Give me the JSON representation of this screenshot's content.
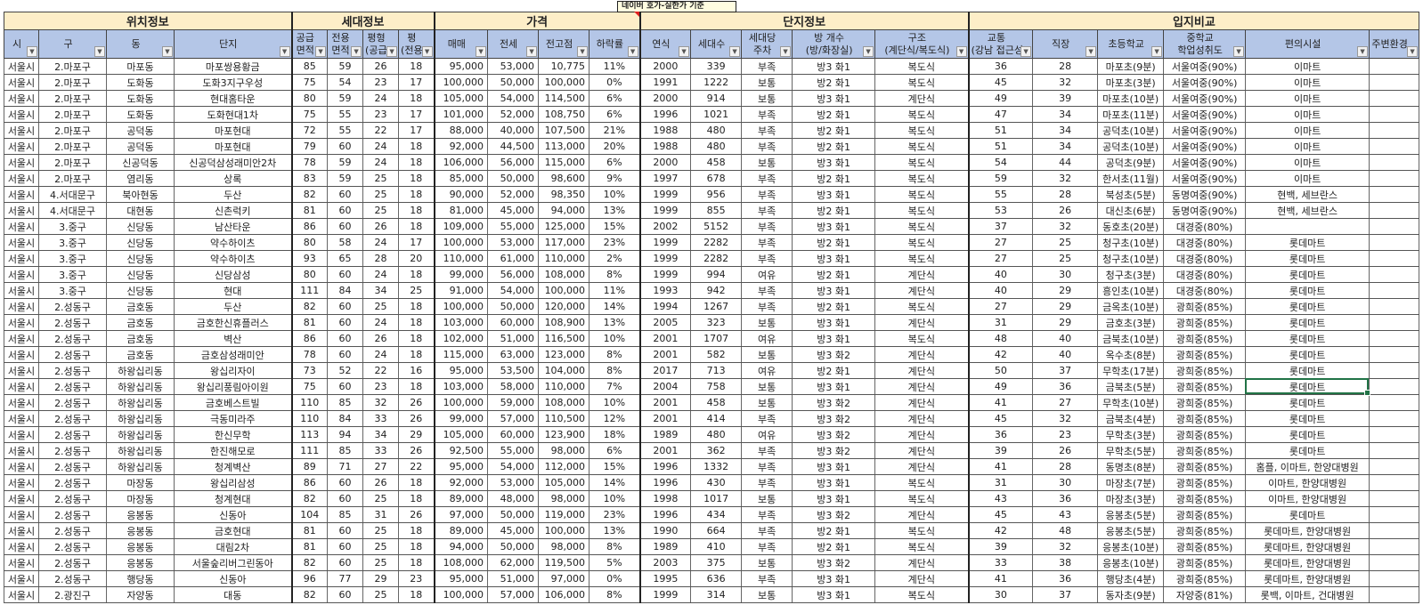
{
  "comment": "네이버 호가-실한가 기준",
  "groups": [
    {
      "label": "위치정보",
      "span": 4
    },
    {
      "label": "세대정보",
      "span": 4
    },
    {
      "label": "가격",
      "span": 4
    },
    {
      "label": "단지정보",
      "span": 5
    },
    {
      "label": "입지비교",
      "span": 6
    }
  ],
  "columns": [
    "시",
    "구",
    "동",
    "단지",
    "공급\n면적",
    "전용\n면적",
    "평형\n(공급)",
    "평\n(전용)",
    "매매",
    "전세",
    "전고점",
    "하락률",
    "연식",
    "세대수",
    "세대당\n주차",
    "방 개수\n(방/화장실)",
    "구조\n(계단식/복도식)",
    "교통\n(강남 접근성)",
    "직장",
    "초등학교",
    "중학교\n학업성취도",
    "편의시설",
    "주변환경"
  ],
  "selected_cell": {
    "row": 21,
    "column": "편의시설"
  },
  "rows": [
    [
      "서울시",
      "2.마포구",
      "마포동",
      "마포쌍용황금",
      "85",
      "59",
      "26",
      "18",
      "95,000",
      "53,000",
      "10,775",
      "11%",
      "2000",
      "339",
      "부족",
      "방3 화1",
      "복도식",
      "36",
      "28",
      "마포초(9분)",
      "서울여중(90%)",
      "이마트",
      ""
    ],
    [
      "서울시",
      "2.마포구",
      "도화동",
      "도화3지구우성",
      "75",
      "54",
      "23",
      "17",
      "100,000",
      "50,000",
      "100,000",
      "0%",
      "1991",
      "1222",
      "보통",
      "방2 화1",
      "복도식",
      "45",
      "32",
      "마포초(3분)",
      "서울여중(90%)",
      "이마트",
      ""
    ],
    [
      "서울시",
      "2.마포구",
      "도화동",
      "현대홈타운",
      "80",
      "59",
      "24",
      "18",
      "105,000",
      "54,000",
      "114,500",
      "6%",
      "2000",
      "914",
      "보통",
      "방3 화1",
      "계단식",
      "49",
      "39",
      "마포초(10분)",
      "서울여중(90%)",
      "이마트",
      ""
    ],
    [
      "서울시",
      "2.마포구",
      "도화동",
      "도화현대1차",
      "75",
      "55",
      "23",
      "17",
      "101,000",
      "52,000",
      "108,750",
      "6%",
      "1996",
      "1021",
      "부족",
      "방2 화1",
      "복도식",
      "47",
      "34",
      "마포초(11분)",
      "서울여중(90%)",
      "이마트",
      ""
    ],
    [
      "서울시",
      "2.마포구",
      "공덕동",
      "마포현대",
      "72",
      "55",
      "22",
      "17",
      "88,000",
      "40,000",
      "107,500",
      "21%",
      "1988",
      "480",
      "부족",
      "방2 화1",
      "복도식",
      "51",
      "34",
      "공덕초(10분)",
      "서울여중(90%)",
      "이마트",
      ""
    ],
    [
      "서울시",
      "2.마포구",
      "공덕동",
      "마포현대",
      "79",
      "60",
      "24",
      "18",
      "92,000",
      "44,500",
      "113,000",
      "20%",
      "1988",
      "480",
      "부족",
      "방2 화1",
      "복도식",
      "51",
      "34",
      "공덕초(10분)",
      "서울여중(90%)",
      "이마트",
      ""
    ],
    [
      "서울시",
      "2.마포구",
      "신공덕동",
      "신공덕삼성래미안2차",
      "78",
      "59",
      "24",
      "18",
      "106,000",
      "56,000",
      "115,000",
      "6%",
      "2000",
      "458",
      "보통",
      "방3 화1",
      "복도식",
      "54",
      "44",
      "공덕초(9분)",
      "서울여중(90%)",
      "이마트",
      ""
    ],
    [
      "서울시",
      "2.마포구",
      "염리동",
      "상록",
      "83",
      "59",
      "25",
      "18",
      "85,000",
      "50,000",
      "98,600",
      "9%",
      "1997",
      "678",
      "부족",
      "방2 화1",
      "복도식",
      "59",
      "32",
      "한서초(11월)",
      "서울여중(90%)",
      "이마트",
      ""
    ],
    [
      "서울시",
      "4.서대문구",
      "북아현동",
      "두산",
      "82",
      "60",
      "25",
      "18",
      "90,000",
      "52,000",
      "98,350",
      "10%",
      "1999",
      "956",
      "부족",
      "방3 화1",
      "복도식",
      "55",
      "28",
      "북성초(5분)",
      "동명여중(90%)",
      "현백, 세브란스",
      ""
    ],
    [
      "서울시",
      "4.서대문구",
      "대현동",
      "신촌럭키",
      "81",
      "60",
      "25",
      "18",
      "81,000",
      "45,000",
      "94,000",
      "13%",
      "1999",
      "855",
      "부족",
      "방2 화1",
      "복도식",
      "53",
      "26",
      "대신초(6분)",
      "동명여중(90%)",
      "현백, 세브란스",
      ""
    ],
    [
      "서울시",
      "3.중구",
      "신당동",
      "남산타운",
      "86",
      "60",
      "26",
      "18",
      "109,000",
      "55,000",
      "125,000",
      "15%",
      "2002",
      "5152",
      "부족",
      "방3 화1",
      "복도식",
      "37",
      "32",
      "동호초(20분)",
      "대경중(80%)",
      "",
      ""
    ],
    [
      "서울시",
      "3.중구",
      "신당동",
      "약수하이츠",
      "80",
      "58",
      "24",
      "17",
      "100,000",
      "53,000",
      "117,000",
      "23%",
      "1999",
      "2282",
      "부족",
      "방2 화1",
      "복도식",
      "27",
      "25",
      "청구초(10분)",
      "대경중(80%)",
      "롯데마트",
      ""
    ],
    [
      "서울시",
      "3.중구",
      "신당동",
      "약수하이츠",
      "93",
      "65",
      "28",
      "20",
      "110,000",
      "61,000",
      "110,000",
      "2%",
      "1999",
      "2282",
      "부족",
      "방3 화1",
      "복도식",
      "27",
      "25",
      "청구초(10분)",
      "대경중(80%)",
      "롯데마트",
      ""
    ],
    [
      "서울시",
      "3.중구",
      "신당동",
      "신당삼성",
      "80",
      "60",
      "24",
      "18",
      "99,000",
      "56,000",
      "108,000",
      "8%",
      "1999",
      "994",
      "여유",
      "방2 화1",
      "계단식",
      "40",
      "30",
      "청구초(3분)",
      "대경중(80%)",
      "롯데마트",
      ""
    ],
    [
      "서울시",
      "3.중구",
      "신당동",
      "현대",
      "111",
      "84",
      "34",
      "25",
      "91,000",
      "54,000",
      "100,000",
      "11%",
      "1993",
      "942",
      "부족",
      "방3 화1",
      "계단식",
      "40",
      "29",
      "흥인초(10분)",
      "대경중(80%)",
      "롯데마트",
      ""
    ],
    [
      "서울시",
      "2.성동구",
      "금호동",
      "두산",
      "82",
      "60",
      "25",
      "18",
      "100,000",
      "50,000",
      "120,000",
      "14%",
      "1994",
      "1267",
      "부족",
      "방2 화1",
      "복도식",
      "27",
      "29",
      "금옥초(10분)",
      "광희중(85%)",
      "롯데마트",
      ""
    ],
    [
      "서울시",
      "2.성동구",
      "금호동",
      "금호한신휴플러스",
      "81",
      "60",
      "24",
      "18",
      "103,000",
      "60,000",
      "108,900",
      "13%",
      "2005",
      "323",
      "보통",
      "방3 화1",
      "계단식",
      "31",
      "29",
      "금호초(3분)",
      "광희중(85%)",
      "롯데마트",
      ""
    ],
    [
      "서울시",
      "2.성동구",
      "금호동",
      "벽산",
      "86",
      "60",
      "26",
      "18",
      "102,000",
      "51,000",
      "116,500",
      "10%",
      "2001",
      "1707",
      "여유",
      "방3 화1",
      "복도식",
      "48",
      "40",
      "금북초(10분)",
      "광희중(85%)",
      "롯데마트",
      ""
    ],
    [
      "서울시",
      "2.성동구",
      "금호동",
      "금호삼성래미안",
      "78",
      "60",
      "24",
      "18",
      "115,000",
      "63,000",
      "123,000",
      "8%",
      "2001",
      "582",
      "보통",
      "방3 화2",
      "계단식",
      "42",
      "40",
      "옥수초(8분)",
      "광희중(85%)",
      "롯데마트",
      ""
    ],
    [
      "서울시",
      "2.성동구",
      "하왕십리동",
      "왕십리자이",
      "73",
      "52",
      "22",
      "16",
      "95,000",
      "53,500",
      "104,000",
      "8%",
      "2017",
      "713",
      "여유",
      "방2 화1",
      "계단식",
      "50",
      "37",
      "무학초(17분)",
      "광희중(85%)",
      "롯데마트",
      ""
    ],
    [
      "서울시",
      "2.성동구",
      "하왕십리동",
      "왕십리풍림아이원",
      "75",
      "60",
      "23",
      "18",
      "103,000",
      "58,000",
      "110,000",
      "7%",
      "2004",
      "758",
      "보통",
      "방3 화1",
      "계단식",
      "49",
      "36",
      "금북초(5분)",
      "광희중(85%)",
      "롯데마트",
      ""
    ],
    [
      "서울시",
      "2.성동구",
      "하왕십리동",
      "금호베스트빌",
      "110",
      "85",
      "32",
      "26",
      "100,000",
      "59,000",
      "108,000",
      "10%",
      "2001",
      "458",
      "보통",
      "방3 화2",
      "계단식",
      "41",
      "27",
      "무학초(10분)",
      "광희중(85%)",
      "롯데마트",
      ""
    ],
    [
      "서울시",
      "2.성동구",
      "하왕십리동",
      "극동미라주",
      "110",
      "84",
      "33",
      "26",
      "99,000",
      "57,000",
      "110,500",
      "12%",
      "2001",
      "414",
      "부족",
      "방3 화2",
      "계단식",
      "45",
      "32",
      "금북초(4분)",
      "광희중(85%)",
      "롯데마트",
      ""
    ],
    [
      "서울시",
      "2.성동구",
      "하왕십리동",
      "한신무학",
      "113",
      "94",
      "34",
      "29",
      "105,000",
      "60,000",
      "123,900",
      "18%",
      "1989",
      "480",
      "여유",
      "방3 화2",
      "계단식",
      "36",
      "23",
      "무학초(3분)",
      "광희중(85%)",
      "롯데마트",
      ""
    ],
    [
      "서울시",
      "2.성동구",
      "하왕십리동",
      "한진해모로",
      "111",
      "85",
      "33",
      "26",
      "92,500",
      "55,000",
      "98,000",
      "6%",
      "2001",
      "362",
      "부족",
      "방3 화2",
      "계단식",
      "39",
      "26",
      "무학초(5분)",
      "광희중(85%)",
      "롯데마트",
      ""
    ],
    [
      "서울시",
      "2.성동구",
      "하왕십리동",
      "청계벽산",
      "89",
      "71",
      "27",
      "22",
      "95,000",
      "54,000",
      "112,000",
      "15%",
      "1996",
      "1332",
      "부족",
      "방3 화1",
      "계단식",
      "41",
      "28",
      "동명초(8분)",
      "광희중(85%)",
      "홈플, 이마트, 한양대병원",
      ""
    ],
    [
      "서울시",
      "2.성동구",
      "마장동",
      "왕십리삼성",
      "86",
      "60",
      "26",
      "18",
      "92,000",
      "53,000",
      "105,000",
      "14%",
      "1996",
      "430",
      "부족",
      "방3 화1",
      "복도식",
      "31",
      "30",
      "마장초(7분)",
      "광희중(85%)",
      "이마트, 한양대병원",
      ""
    ],
    [
      "서울시",
      "2.성동구",
      "마장동",
      "청계현대",
      "82",
      "60",
      "25",
      "18",
      "89,000",
      "48,000",
      "98,000",
      "10%",
      "1998",
      "1017",
      "보통",
      "방3 화1",
      "복도식",
      "43",
      "36",
      "마장초(3분)",
      "광희중(85%)",
      "이마트, 한양대병원",
      ""
    ],
    [
      "서울시",
      "2.성동구",
      "응봉동",
      "신동아",
      "104",
      "85",
      "31",
      "26",
      "97,000",
      "50,000",
      "119,000",
      "23%",
      "1996",
      "434",
      "부족",
      "방3 화2",
      "계단식",
      "45",
      "43",
      "응봉초(5분)",
      "광희중(85%)",
      "롯데마트",
      ""
    ],
    [
      "서울시",
      "2.성동구",
      "응봉동",
      "금호현대",
      "81",
      "60",
      "25",
      "18",
      "89,000",
      "45,000",
      "100,000",
      "13%",
      "1990",
      "664",
      "부족",
      "방2 화1",
      "복도식",
      "42",
      "48",
      "응봉초(5분)",
      "광희중(85%)",
      "롯데마트, 한양대병원",
      ""
    ],
    [
      "서울시",
      "2.성동구",
      "응봉동",
      "대림2차",
      "81",
      "60",
      "25",
      "18",
      "94,000",
      "50,000",
      "98,000",
      "8%",
      "1989",
      "410",
      "부족",
      "방2 화1",
      "복도식",
      "39",
      "32",
      "응봉초(10분)",
      "광희중(85%)",
      "롯데마트, 한양대병원",
      ""
    ],
    [
      "서울시",
      "2.성동구",
      "응봉동",
      "서울숲리버그린동아",
      "82",
      "60",
      "25",
      "18",
      "108,000",
      "62,000",
      "119,500",
      "5%",
      "2003",
      "375",
      "보통",
      "방3 화2",
      "계단식",
      "33",
      "38",
      "응봉초(10분)",
      "광희중(85%)",
      "롯데마트, 한양대병원",
      ""
    ],
    [
      "서울시",
      "2.성동구",
      "행당동",
      "신동아",
      "96",
      "77",
      "29",
      "23",
      "95,000",
      "51,000",
      "97,000",
      "0%",
      "1995",
      "636",
      "부족",
      "방3 화1",
      "계단식",
      "41",
      "36",
      "행당초(4분)",
      "광희중(85%)",
      "롯데마트, 한양대병원",
      ""
    ],
    [
      "서울시",
      "2.광진구",
      "자양동",
      "대동",
      "82",
      "60",
      "25",
      "18",
      "100,000",
      "57,000",
      "106,000",
      "8%",
      "1999",
      "314",
      "보통",
      "방3 화1",
      "복도식",
      "30",
      "37",
      "동자초(9분)",
      "자양중(81%)",
      "롯백, 이마트, 건대병원",
      ""
    ]
  ]
}
